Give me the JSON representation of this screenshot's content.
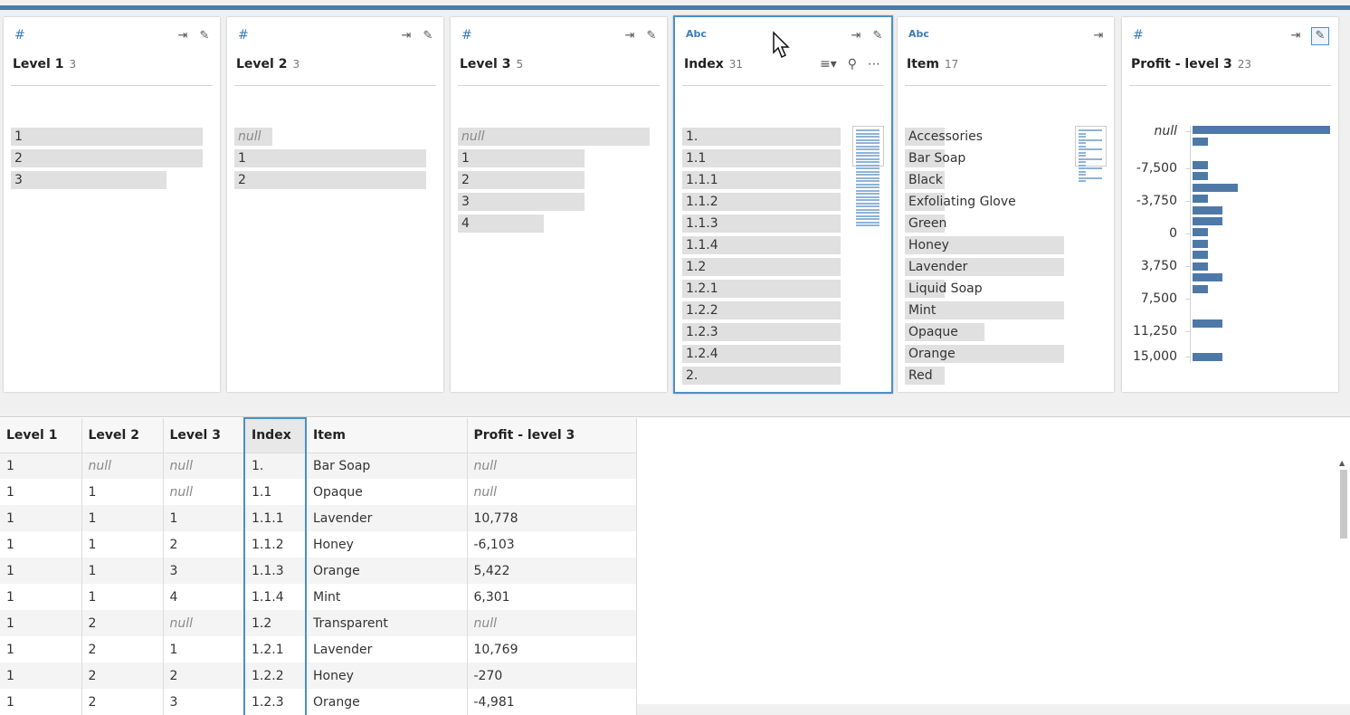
{
  "cards": [
    {
      "type": "#",
      "title": "Level 1",
      "count": "3",
      "bars": [
        {
          "label": "1",
          "fraction": 1.0
        },
        {
          "label": "2",
          "fraction": 1.0
        },
        {
          "label": "3",
          "fraction": 0.81
        }
      ]
    },
    {
      "type": "#",
      "title": "Level 2",
      "count": "3",
      "bars": [
        {
          "label": "null",
          "fraction": 0.2
        },
        {
          "label": "1",
          "fraction": 1.0
        },
        {
          "label": "2",
          "fraction": 1.0
        }
      ]
    },
    {
      "type": "#",
      "title": "Level 3",
      "count": "5",
      "bars": [
        {
          "label": "null",
          "fraction": 1.0
        },
        {
          "label": "1",
          "fraction": 0.66
        },
        {
          "label": "2",
          "fraction": 0.66
        },
        {
          "label": "3",
          "fraction": 0.66
        },
        {
          "label": "4",
          "fraction": 0.45
        }
      ]
    },
    {
      "type": "Abc",
      "title": "Index",
      "count": "31",
      "bars": [
        {
          "label": "1."
        },
        {
          "label": "1.1"
        },
        {
          "label": "1.1.1"
        },
        {
          "label": "1.1.2"
        },
        {
          "label": "1.1.3"
        },
        {
          "label": "1.1.4"
        },
        {
          "label": "1.2"
        },
        {
          "label": "1.2.1"
        },
        {
          "label": "1.2.2"
        },
        {
          "label": "1.2.3"
        },
        {
          "label": "1.2.4"
        },
        {
          "label": "2."
        }
      ]
    },
    {
      "type": "Abc",
      "title": "Item",
      "count": "17",
      "bars": [
        {
          "label": "Accessories",
          "fraction": 0.25
        },
        {
          "label": "Bar Soap",
          "fraction": 0.25
        },
        {
          "label": "Black",
          "fraction": 0.25
        },
        {
          "label": "Exfoliating Glove",
          "fraction": 0.25
        },
        {
          "label": "Green",
          "fraction": 0.25
        },
        {
          "label": "Honey",
          "fraction": 1.0
        },
        {
          "label": "Lavender",
          "fraction": 1.0
        },
        {
          "label": "Liquid Soap",
          "fraction": 0.25
        },
        {
          "label": "Mint",
          "fraction": 1.0
        },
        {
          "label": "Opaque",
          "fraction": 0.5
        },
        {
          "label": "Orange",
          "fraction": 1.0
        },
        {
          "label": "Red",
          "fraction": 0.25
        }
      ]
    },
    {
      "type": "#",
      "title": "Profit - level 3",
      "count": "23",
      "axis": [
        {
          "label": "null",
          "null": true
        },
        {
          "label": "-7,500"
        },
        {
          "label": "-3,750"
        },
        {
          "label": "0"
        },
        {
          "label": "3,750"
        },
        {
          "label": "7,500"
        },
        {
          "label": "11,250"
        },
        {
          "label": "15,000"
        }
      ],
      "hist": [
        1.0,
        0.11,
        0.11,
        0.11,
        0.33,
        0.11,
        0.22,
        0.22,
        0.11,
        0.11,
        0.11,
        0.11,
        0.22,
        0.11,
        0.22,
        0.22
      ]
    }
  ],
  "grid": {
    "columns": [
      "Level 1",
      "Level 2",
      "Level 3",
      "Index",
      "Item",
      "Profit - level 3"
    ],
    "rows": [
      [
        "1",
        "null",
        "null",
        "1.",
        "Bar Soap",
        "null"
      ],
      [
        "1",
        "1",
        "null",
        "1.1",
        "Opaque",
        "null"
      ],
      [
        "1",
        "1",
        "1",
        "1.1.1",
        "Lavender",
        "10,778"
      ],
      [
        "1",
        "1",
        "2",
        "1.1.2",
        "Honey",
        "-6,103"
      ],
      [
        "1",
        "1",
        "3",
        "1.1.3",
        "Orange",
        "5,422"
      ],
      [
        "1",
        "1",
        "4",
        "1.1.4",
        "Mint",
        "6,301"
      ],
      [
        "1",
        "2",
        "null",
        "1.2",
        "Transparent",
        "null"
      ],
      [
        "1",
        "2",
        "1",
        "1.2.1",
        "Lavender",
        "10,769"
      ],
      [
        "1",
        "2",
        "2",
        "1.2.2",
        "Honey",
        "-270"
      ],
      [
        "1",
        "2",
        "3",
        "1.2.3",
        "Orange",
        "-4,981"
      ]
    ]
  },
  "icons": {
    "number_type": "hash-icon",
    "string_type": "abc-icon"
  }
}
